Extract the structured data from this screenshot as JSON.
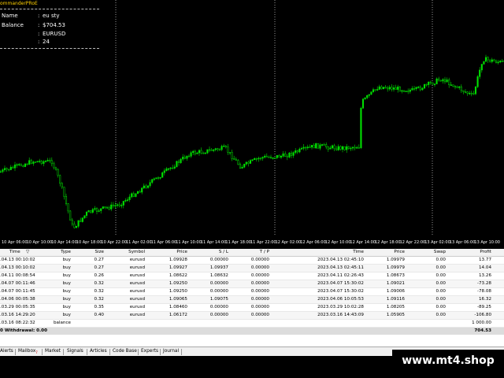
{
  "panel": {
    "title": "ommanderPRoE",
    "rows": [
      {
        "key": "Name",
        "value": "eu sty"
      },
      {
        "key": "Balance",
        "value": "$704.53"
      },
      {
        "key": "",
        "value": "EURUSD"
      },
      {
        "key": "",
        "value": "24"
      }
    ],
    "separator": ":"
  },
  "time_axis": [
    "10 Apr 06:00",
    "10 Apr 10:00",
    "10 Apr 14:00",
    "10 Apr 18:00",
    "10 Apr 22:00",
    "11 Apr 02:00",
    "11 Apr 06:00",
    "11 Apr 10:00",
    "11 Apr 14:00",
    "11 Apr 18:00",
    "11 Apr 22:00",
    "12 Apr 02:00",
    "12 Apr 06:00",
    "12 Apr 10:00",
    "12 Apr 14:00",
    "12 Apr 18:00",
    "12 Apr 22:00",
    "13 Apr 02:00",
    "13 Apr 06:00",
    "13 Apr 10:00"
  ],
  "colors": {
    "candles": "#00e000",
    "grid": "#bbbbbb",
    "balance_panel": "#ffd000"
  },
  "terminal": {
    "headers": {
      "time": "Time",
      "type": "Type",
      "size": "Size",
      "symbol": "Symbol",
      "price": "Price",
      "sl": "S / L",
      "tp": "T / P",
      "close_time": "Time",
      "close_price": "Price",
      "swap": "Swap",
      "profit": "Profit"
    },
    "rows": [
      {
        "time": ".04.13 00:10:02",
        "type": "buy",
        "size": "0.27",
        "symbol": "eurusd",
        "price": "1.09928",
        "sl": "0.00000",
        "tp": "0.00000",
        "close_time": "2023.04.13 02:45:10",
        "close_price": "1.09979",
        "swap": "0.00",
        "profit": "13.77"
      },
      {
        "time": ".04.13 00:10:02",
        "type": "buy",
        "size": "0.27",
        "symbol": "eurusd",
        "price": "1.09927",
        "sl": "1.09937",
        "tp": "0.00000",
        "close_time": "2023.04.13 02:45:11",
        "close_price": "1.09979",
        "swap": "0.00",
        "profit": "14.04"
      },
      {
        "time": ".04.11 00:08:54",
        "type": "buy",
        "size": "0.26",
        "symbol": "eurusd",
        "price": "1.08622",
        "sl": "1.08632",
        "tp": "0.00000",
        "close_time": "2023.04.11 02:26:43",
        "close_price": "1.08673",
        "swap": "0.00",
        "profit": "13.26"
      },
      {
        "time": ".04.07 00:11:46",
        "type": "buy",
        "size": "0.32",
        "symbol": "eurusd",
        "price": "1.09250",
        "sl": "0.00000",
        "tp": "0.00000",
        "close_time": "2023.04.07 15:30:02",
        "close_price": "1.09021",
        "swap": "0.00",
        "profit": "-73.28"
      },
      {
        "time": ".04.07 00:11:45",
        "type": "buy",
        "size": "0.32",
        "symbol": "eurusd",
        "price": "1.09250",
        "sl": "0.00000",
        "tp": "0.00000",
        "close_time": "2023.04.07 15:30:02",
        "close_price": "1.09006",
        "swap": "0.00",
        "profit": "-78.08"
      },
      {
        "time": ".04.06 00:05:38",
        "type": "buy",
        "size": "0.32",
        "symbol": "eurusd",
        "price": "1.09065",
        "sl": "1.09075",
        "tp": "0.00000",
        "close_time": "2023.04.06 10:05:53",
        "close_price": "1.09116",
        "swap": "0.00",
        "profit": "16.32"
      },
      {
        "time": ".03.29 00:05:35",
        "type": "buy",
        "size": "0.35",
        "symbol": "eurusd",
        "price": "1.08460",
        "sl": "0.00000",
        "tp": "0.00000",
        "close_time": "2023.03.29 10:02:28",
        "close_price": "1.08205",
        "swap": "0.00",
        "profit": "-89.25"
      },
      {
        "time": ".03.16 14:29:20",
        "type": "buy",
        "size": "0.40",
        "symbol": "eurusd",
        "price": "1.06172",
        "sl": "0.00000",
        "tp": "0.00000",
        "close_time": "2023.03.16 14:43:09",
        "close_price": "1.05905",
        "swap": "0.00",
        "profit": "-106.80"
      },
      {
        "time": ".03.16 08:22:32",
        "type": "balance",
        "size": "",
        "symbol": "",
        "price": "",
        "sl": "",
        "tp": "",
        "close_time": "",
        "close_price": "",
        "swap": "",
        "profit": "1 000.00"
      }
    ],
    "summary": {
      "label": "0  Withdrawal: 0.00",
      "value": "704.53"
    }
  },
  "tabs": [
    "Alerts",
    "Mailbox",
    "Market",
    "Signals",
    "Articles",
    "Code Base",
    "Experts",
    "Journal"
  ],
  "mailbox_badge": "7",
  "brand": "www.mt4.shop"
}
